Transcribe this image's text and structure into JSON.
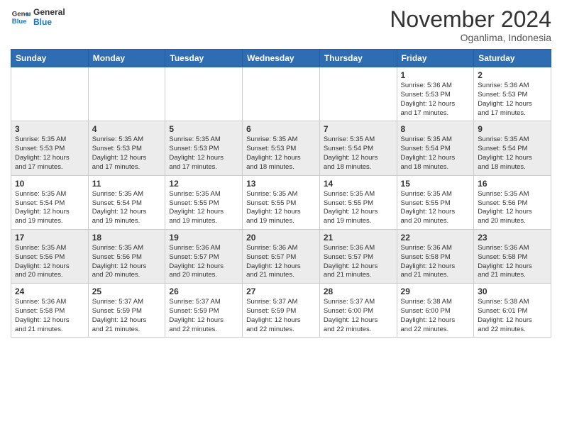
{
  "header": {
    "logo_line1": "General",
    "logo_line2": "Blue",
    "month": "November 2024",
    "location": "Oganlima, Indonesia"
  },
  "weekdays": [
    "Sunday",
    "Monday",
    "Tuesday",
    "Wednesday",
    "Thursday",
    "Friday",
    "Saturday"
  ],
  "rows": [
    {
      "rowClass": "row-1",
      "cells": [
        {
          "empty": true
        },
        {
          "empty": true
        },
        {
          "empty": true
        },
        {
          "empty": true
        },
        {
          "empty": true
        },
        {
          "day": "1",
          "info": "Sunrise: 5:36 AM\nSunset: 5:53 PM\nDaylight: 12 hours\nand 17 minutes."
        },
        {
          "day": "2",
          "info": "Sunrise: 5:36 AM\nSunset: 5:53 PM\nDaylight: 12 hours\nand 17 minutes."
        }
      ]
    },
    {
      "rowClass": "row-2",
      "cells": [
        {
          "day": "3",
          "info": "Sunrise: 5:35 AM\nSunset: 5:53 PM\nDaylight: 12 hours\nand 17 minutes."
        },
        {
          "day": "4",
          "info": "Sunrise: 5:35 AM\nSunset: 5:53 PM\nDaylight: 12 hours\nand 17 minutes."
        },
        {
          "day": "5",
          "info": "Sunrise: 5:35 AM\nSunset: 5:53 PM\nDaylight: 12 hours\nand 17 minutes."
        },
        {
          "day": "6",
          "info": "Sunrise: 5:35 AM\nSunset: 5:53 PM\nDaylight: 12 hours\nand 18 minutes."
        },
        {
          "day": "7",
          "info": "Sunrise: 5:35 AM\nSunset: 5:54 PM\nDaylight: 12 hours\nand 18 minutes."
        },
        {
          "day": "8",
          "info": "Sunrise: 5:35 AM\nSunset: 5:54 PM\nDaylight: 12 hours\nand 18 minutes."
        },
        {
          "day": "9",
          "info": "Sunrise: 5:35 AM\nSunset: 5:54 PM\nDaylight: 12 hours\nand 18 minutes."
        }
      ]
    },
    {
      "rowClass": "row-3",
      "cells": [
        {
          "day": "10",
          "info": "Sunrise: 5:35 AM\nSunset: 5:54 PM\nDaylight: 12 hours\nand 19 minutes."
        },
        {
          "day": "11",
          "info": "Sunrise: 5:35 AM\nSunset: 5:54 PM\nDaylight: 12 hours\nand 19 minutes."
        },
        {
          "day": "12",
          "info": "Sunrise: 5:35 AM\nSunset: 5:55 PM\nDaylight: 12 hours\nand 19 minutes."
        },
        {
          "day": "13",
          "info": "Sunrise: 5:35 AM\nSunset: 5:55 PM\nDaylight: 12 hours\nand 19 minutes."
        },
        {
          "day": "14",
          "info": "Sunrise: 5:35 AM\nSunset: 5:55 PM\nDaylight: 12 hours\nand 19 minutes."
        },
        {
          "day": "15",
          "info": "Sunrise: 5:35 AM\nSunset: 5:55 PM\nDaylight: 12 hours\nand 20 minutes."
        },
        {
          "day": "16",
          "info": "Sunrise: 5:35 AM\nSunset: 5:56 PM\nDaylight: 12 hours\nand 20 minutes."
        }
      ]
    },
    {
      "rowClass": "row-4",
      "cells": [
        {
          "day": "17",
          "info": "Sunrise: 5:35 AM\nSunset: 5:56 PM\nDaylight: 12 hours\nand 20 minutes."
        },
        {
          "day": "18",
          "info": "Sunrise: 5:35 AM\nSunset: 5:56 PM\nDaylight: 12 hours\nand 20 minutes."
        },
        {
          "day": "19",
          "info": "Sunrise: 5:36 AM\nSunset: 5:57 PM\nDaylight: 12 hours\nand 20 minutes."
        },
        {
          "day": "20",
          "info": "Sunrise: 5:36 AM\nSunset: 5:57 PM\nDaylight: 12 hours\nand 21 minutes."
        },
        {
          "day": "21",
          "info": "Sunrise: 5:36 AM\nSunset: 5:57 PM\nDaylight: 12 hours\nand 21 minutes."
        },
        {
          "day": "22",
          "info": "Sunrise: 5:36 AM\nSunset: 5:58 PM\nDaylight: 12 hours\nand 21 minutes."
        },
        {
          "day": "23",
          "info": "Sunrise: 5:36 AM\nSunset: 5:58 PM\nDaylight: 12 hours\nand 21 minutes."
        }
      ]
    },
    {
      "rowClass": "row-5",
      "cells": [
        {
          "day": "24",
          "info": "Sunrise: 5:36 AM\nSunset: 5:58 PM\nDaylight: 12 hours\nand 21 minutes."
        },
        {
          "day": "25",
          "info": "Sunrise: 5:37 AM\nSunset: 5:59 PM\nDaylight: 12 hours\nand 21 minutes."
        },
        {
          "day": "26",
          "info": "Sunrise: 5:37 AM\nSunset: 5:59 PM\nDaylight: 12 hours\nand 22 minutes."
        },
        {
          "day": "27",
          "info": "Sunrise: 5:37 AM\nSunset: 5:59 PM\nDaylight: 12 hours\nand 22 minutes."
        },
        {
          "day": "28",
          "info": "Sunrise: 5:37 AM\nSunset: 6:00 PM\nDaylight: 12 hours\nand 22 minutes."
        },
        {
          "day": "29",
          "info": "Sunrise: 5:38 AM\nSunset: 6:00 PM\nDaylight: 12 hours\nand 22 minutes."
        },
        {
          "day": "30",
          "info": "Sunrise: 5:38 AM\nSunset: 6:01 PM\nDaylight: 12 hours\nand 22 minutes."
        }
      ]
    }
  ]
}
